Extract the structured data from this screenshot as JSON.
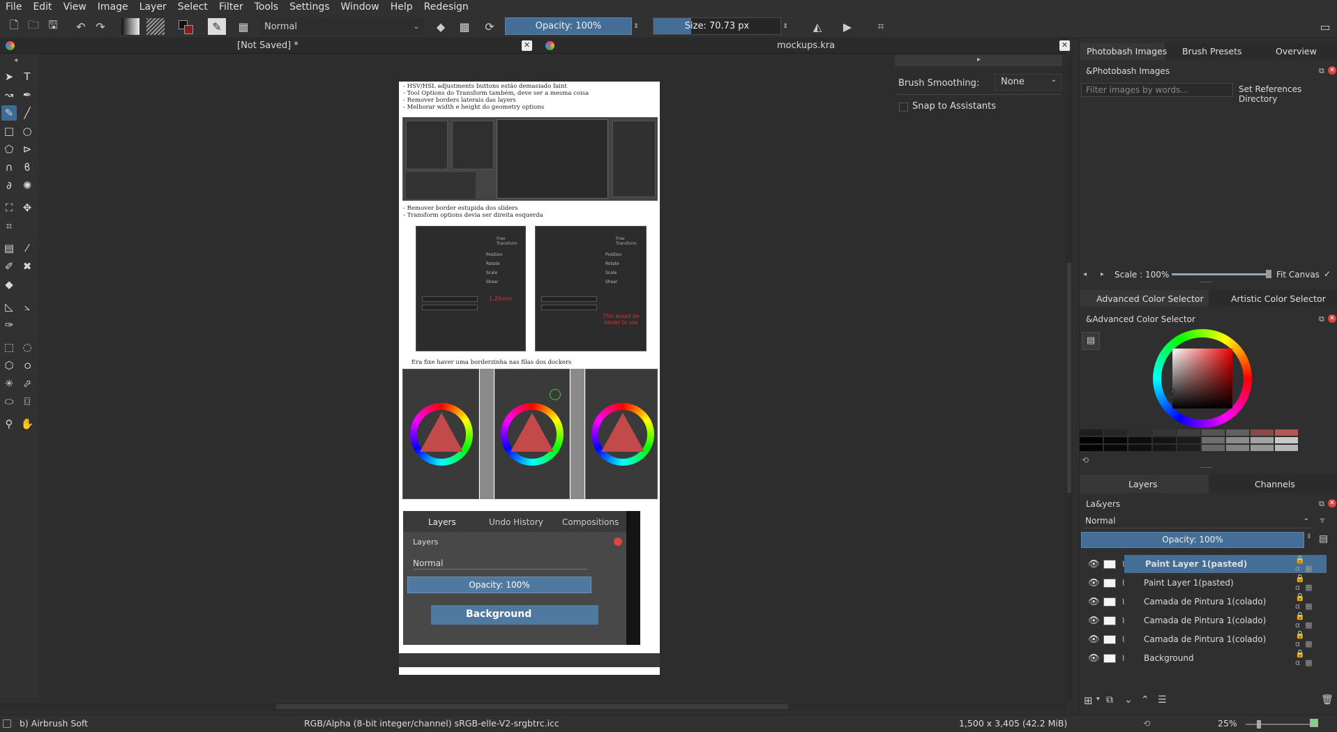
{
  "menubar": [
    "File",
    "Edit",
    "View",
    "Image",
    "Layer",
    "Select",
    "Filter",
    "Tools",
    "Settings",
    "Window",
    "Help",
    "Redesign"
  ],
  "toolbar": {
    "blend_mode": "Normal",
    "opacity_label": "Opacity: 100%",
    "size_label": "Size: 70.73 px"
  },
  "tabs": [
    {
      "title": "[Not Saved]  *"
    },
    {
      "title": "mockups.kra"
    }
  ],
  "canvas_notes": {
    "block1": [
      "- HSV/HSL adjustments buttons estão demasiado faint",
      "- Tool Options do Transform também, deve ser a mesma coisa",
      "- Remover borders laterais das layers",
      "- Melhorar width e height do geometry options"
    ],
    "block2": [
      "- Remover border estupida dos sliders",
      "- Transform options devia ser direita esquerda"
    ],
    "block3": "Era fixe haver uma borderzinha nas filas dos dockers",
    "mock_tabs": [
      "Layers",
      "Undo History",
      "Compositions"
    ],
    "mock_layers_title": "Layers",
    "mock_blend": "Normal",
    "mock_opacity": "Opacity:  100%",
    "mock_layer": "Background",
    "transform_title": "Free Transform",
    "transform_options": [
      "Position",
      "Rotate",
      "Scale",
      "Shear"
    ],
    "annotation_1": "1.25mm",
    "annotation_2": "This would be easier to use"
  },
  "tool_options": {
    "brush_smoothing_label": "Brush Smoothing:",
    "brush_smoothing_value": "None",
    "snap_label": "Snap to Assistants"
  },
  "photobash": {
    "tabs": [
      "Photobash Images",
      "Brush Presets",
      "Overview"
    ],
    "title": "&Photobash Images",
    "filter_placeholder": "Filter images by words...",
    "set_dir": "Set References Directory",
    "scale": "Scale : 100%",
    "fit": "Fit Canvas"
  },
  "color": {
    "tabs": [
      "Advanced Color Selector",
      "Artistic Color Selector"
    ],
    "title": "&Advanced Color Selector",
    "swatches_top": [
      "#1e1e1e",
      "#262626",
      "#2e2e2e",
      "#363636",
      "#3e3e3e",
      "#555555",
      "#616161",
      "#8a4848",
      "#b65555"
    ],
    "swatches_bottom": [
      "#000000",
      "#060606",
      "#0c0c0c",
      "#141414",
      "#1c1c1c",
      "#6f6f6f",
      "#8c8c8c",
      "#a3a3a3",
      "#c8c8c8"
    ]
  },
  "layers": {
    "tabs": [
      "Layers",
      "Channels"
    ],
    "title": "La&yers",
    "blend": "Normal",
    "opacity": "Opacity:  100%",
    "items": [
      {
        "name": "Paint Layer 1(pasted)",
        "selected": true
      },
      {
        "name": "Paint Layer 1(pasted)",
        "selected": false
      },
      {
        "name": "Camada de Pintura 1(colado)",
        "selected": false
      },
      {
        "name": "Camada de Pintura 1(colado)",
        "selected": false
      },
      {
        "name": "Camada de Pintura 1(colado)",
        "selected": false
      },
      {
        "name": "Background",
        "selected": false
      }
    ]
  },
  "status": {
    "brush": "b) Airbrush Soft",
    "color_space": "RGB/Alpha (8-bit integer/channel)  sRGB-elle-V2-srgbtrc.icc",
    "dimensions": "1,500 x 3,405 (42.2 MiB)",
    "zoom": "25%"
  }
}
